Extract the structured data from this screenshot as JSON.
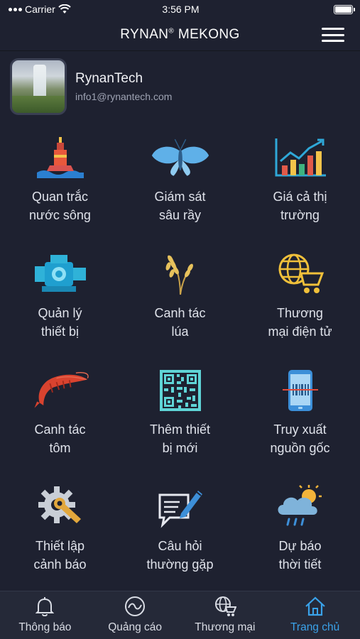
{
  "statusbar": {
    "carrier": "Carrier",
    "time": "3:56 PM"
  },
  "header": {
    "title": "RYNAN",
    "reg": "®",
    "title_suffix": " MEKONG",
    "menu_icon": "hamburger-menu-icon"
  },
  "profile": {
    "name": "RynanTech",
    "email": "info1@rynantech.com"
  },
  "tiles": [
    {
      "label": "Quan trắc\nnước sông",
      "icon": "buoy-icon"
    },
    {
      "label": "Giám sát\nsâu rầy",
      "icon": "moth-icon"
    },
    {
      "label": "Giá cả thị\ntrường",
      "icon": "market-chart-icon"
    },
    {
      "label": "Quản lý\nthiết bị",
      "icon": "pump-device-icon"
    },
    {
      "label": "Canh tác\nlúa",
      "icon": "rice-plant-icon"
    },
    {
      "label": "Thương\nmại điện tử",
      "icon": "globe-cart-icon"
    },
    {
      "label": "Canh tác\ntôm",
      "icon": "shrimp-icon"
    },
    {
      "label": "Thêm thiết\nbị mới",
      "icon": "qr-code-icon"
    },
    {
      "label": "Truy xuất\nnguồn gốc",
      "icon": "phone-barcode-scan-icon"
    },
    {
      "label": "Thiết lập\ncảnh báo",
      "icon": "gear-wrench-icon"
    },
    {
      "label": "Câu hỏi\nthường gặp",
      "icon": "chat-pencil-icon"
    },
    {
      "label": "Dự báo\nthời tiết",
      "icon": "weather-cloud-icon"
    }
  ],
  "tabbar": {
    "items": [
      {
        "label": "Thông báo",
        "icon": "bell-icon"
      },
      {
        "label": "Quảng cáo",
        "icon": "advert-circle-icon"
      },
      {
        "label": "Thương mại",
        "icon": "globe-cart-icon"
      },
      {
        "label": "Trang chủ",
        "icon": "home-icon"
      }
    ],
    "active_index": 3,
    "active_color": "#3aa2e9"
  },
  "colors": {
    "background": "#1e2130",
    "tabbar": "#252938",
    "accent": "#3aa2e9"
  }
}
